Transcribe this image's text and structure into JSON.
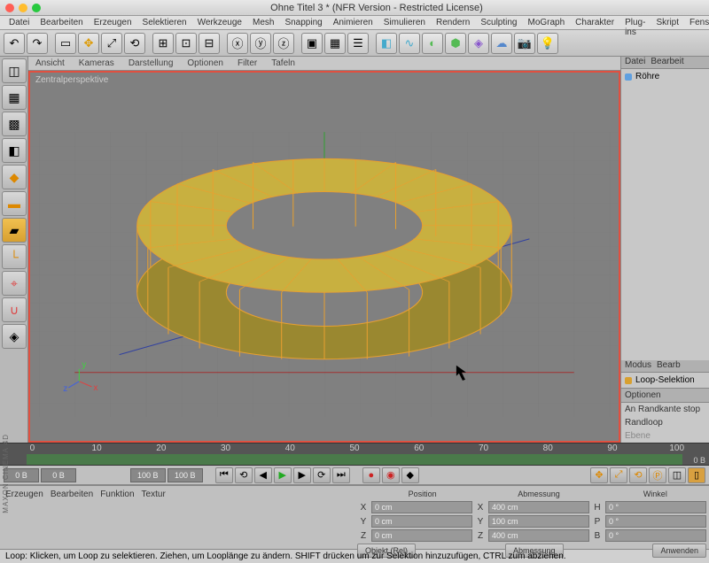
{
  "title": "Ohne Titel 3 * (NFR Version - Restricted License)",
  "menu": [
    "Datei",
    "Bearbeiten",
    "Erzeugen",
    "Selektieren",
    "Werkzeuge",
    "Mesh",
    "Snapping",
    "Animieren",
    "Simulieren",
    "Rendern",
    "Sculpting",
    "MoGraph",
    "Charakter",
    "Plug-ins",
    "Skript",
    "Fenst"
  ],
  "viewtabs": [
    "Ansicht",
    "Kameras",
    "Darstellung",
    "Optionen",
    "Filter",
    "Tafeln"
  ],
  "viewport_label": "Zentralperspektive",
  "right": {
    "tabs1": [
      "Datei",
      "Bearbeit"
    ],
    "object": "Röhre",
    "tabs2": [
      "Modus",
      "Bearb"
    ],
    "tool": "Loop-Selektion",
    "section": "Optionen",
    "opt1": "An Randkante stop",
    "opt2": "Randloop",
    "opt3": "Ebene"
  },
  "timeline": {
    "ticks": [
      "0",
      "10",
      "20",
      "30",
      "40",
      "50",
      "60",
      "70",
      "80",
      "90",
      "100"
    ],
    "end_label": "0 B"
  },
  "frames": {
    "start": "0 B",
    "current": "0 B",
    "total": "100 B",
    "end": "100 B"
  },
  "attr": {
    "tabs": [
      "Erzeugen",
      "Bearbeiten",
      "Funktion",
      "Textur"
    ],
    "cols": [
      "Position",
      "Abmessung",
      "Winkel"
    ],
    "rows": [
      {
        "axis": "X",
        "pos": "0 cm",
        "dim": "400 cm",
        "dimL": "X",
        "ang": "0 °",
        "angL": "H"
      },
      {
        "axis": "Y",
        "pos": "0 cm",
        "dim": "100 cm",
        "dimL": "Y",
        "ang": "0 °",
        "angL": "P"
      },
      {
        "axis": "Z",
        "pos": "0 cm",
        "dim": "400 cm",
        "dimL": "Z",
        "ang": "0 °",
        "angL": "B"
      }
    ],
    "btn1": "Objekt (Rel)",
    "btn2": "Abmessung",
    "btn3": "Anwenden"
  },
  "status": "Loop: Klicken, um Loop zu selektieren. Ziehen, um Looplänge zu ändern. SHIFT drücken um zur Selektion hinzuzufügen, CTRL zum abziehen.",
  "logo": "MAXON CINEMA 4D"
}
